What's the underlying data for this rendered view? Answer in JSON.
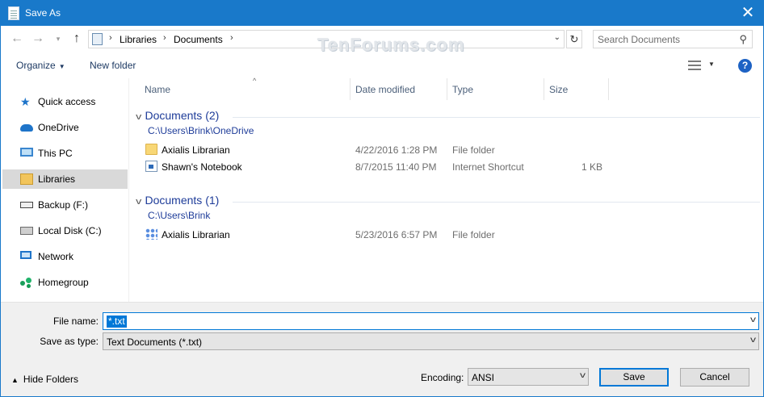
{
  "window": {
    "title": "Save As",
    "close_glyph": "✕"
  },
  "nav": {
    "back_icon": "arrow-left-icon",
    "forward_icon": "arrow-right-icon",
    "up_icon": "arrow-up-icon",
    "address": [
      "Libraries",
      "Documents"
    ],
    "search_placeholder": "Search Documents"
  },
  "watermark": "TenForums.com",
  "toolbar": {
    "organize": "Organize",
    "new_folder": "New folder",
    "help": "?"
  },
  "sidebar": {
    "items": [
      {
        "label": "Quick access",
        "icon": "star-icon"
      },
      {
        "label": "OneDrive",
        "icon": "cloud-icon"
      },
      {
        "label": "This PC",
        "icon": "computer-icon"
      },
      {
        "label": "Libraries",
        "icon": "library-icon",
        "selected": true
      },
      {
        "label": "Backup (F:)",
        "icon": "usb-drive-icon"
      },
      {
        "label": "Local Disk (C:)",
        "icon": "hard-drive-icon"
      },
      {
        "label": "Network",
        "icon": "network-icon"
      },
      {
        "label": "Homegroup",
        "icon": "homegroup-icon"
      }
    ]
  },
  "columns": {
    "name": "Name",
    "date": "Date modified",
    "type": "Type",
    "size": "Size"
  },
  "groups": [
    {
      "title": "Documents (2)",
      "path": "C:\\Users\\Brink\\OneDrive",
      "rows": [
        {
          "name": "Axialis Librarian",
          "date": "4/22/2016 1:28 PM",
          "type": "File folder",
          "size": "",
          "icon": "folder-icon"
        },
        {
          "name": "Shawn's Notebook",
          "date": "8/7/2015 11:40 PM",
          "type": "Internet Shortcut",
          "size": "1 KB",
          "icon": "shortcut-icon"
        }
      ]
    },
    {
      "title": "Documents (1)",
      "path": "C:\\Users\\Brink",
      "rows": [
        {
          "name": "Axialis Librarian",
          "date": "5/23/2016 6:57 PM",
          "type": "File folder",
          "size": "",
          "icon": "app-folder-icon"
        }
      ]
    }
  ],
  "bottom": {
    "file_name_label": "File name:",
    "file_name_value": "*.txt",
    "save_type_label": "Save as type:",
    "save_type_value": "Text Documents (*.txt)",
    "hide_folders": "Hide Folders",
    "encoding_label": "Encoding:",
    "encoding_value": "ANSI",
    "save_button": "Save",
    "cancel_button": "Cancel"
  },
  "colors": {
    "titlebar": "#1979ca",
    "accent": "#0078d7",
    "group_header": "#1e3c99"
  }
}
